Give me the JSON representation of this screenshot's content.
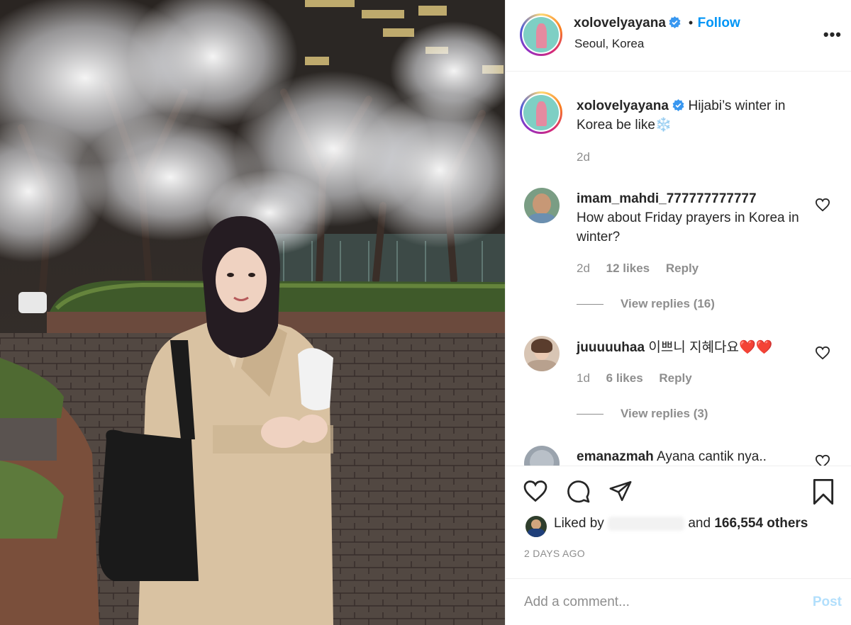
{
  "post": {
    "username": "xolovelyayana",
    "follow_label": "Follow",
    "dot": "•",
    "location": "Seoul, Korea",
    "more_label": "•••",
    "caption": "Hijabi’s winter in Korea be like❄️",
    "caption_age": "2d"
  },
  "comments": [
    {
      "username": "imam_mahdi_777777777777",
      "text": "How about Friday prayers in Korea in winter?",
      "age": "2d",
      "likes": "12 likes",
      "reply_label": "Reply",
      "view_replies": "View replies (16)"
    },
    {
      "username": "juuuuuhaa",
      "text": "이쁘니 지혜다요❤️❤️",
      "age": "1d",
      "likes": "6 likes",
      "reply_label": "Reply",
      "view_replies": "View replies (3)"
    },
    {
      "username": "emanazmah",
      "text": "Ayana cantik nya.."
    }
  ],
  "footer": {
    "liked_by_prefix": "Liked by",
    "liked_by_suffix": "and",
    "likes_count": "166,554 others",
    "date": "2 DAYS AGO",
    "add_comment_placeholder": "Add a comment...",
    "post_label": "Post"
  },
  "colors": {
    "accent": "#0095f6",
    "muted": "#8e8e8e",
    "post_disabled": "#b2dffc",
    "verified": "#3897f0"
  },
  "icons": [
    "verified-icon",
    "heart-icon",
    "comment-icon",
    "share-icon",
    "bookmark-icon",
    "more-icon"
  ]
}
